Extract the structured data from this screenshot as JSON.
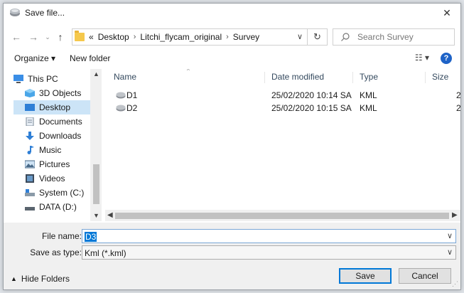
{
  "window": {
    "title": "Save file...",
    "close_label": "✕"
  },
  "address": {
    "back": "←",
    "forward": "→",
    "recent": "⌄",
    "up": "↑",
    "overflow": "«",
    "crumbs": [
      "Desktop",
      "Litchi_flycam_original",
      "Survey"
    ],
    "separator": "›",
    "dropdown": "∨",
    "refresh": "↻"
  },
  "search": {
    "placeholder": "Search Survey"
  },
  "toolbar": {
    "organize_label": "Organize ▾",
    "new_folder_label": "New folder",
    "view_label": "☷ ▾",
    "help_label": "?"
  },
  "nav": {
    "items": [
      {
        "label": "This PC",
        "icon": "pc-icon"
      },
      {
        "label": "3D Objects",
        "icon": "cube-icon"
      },
      {
        "label": "Desktop",
        "icon": "desktop-icon",
        "selected": true
      },
      {
        "label": "Documents",
        "icon": "document-icon"
      },
      {
        "label": "Downloads",
        "icon": "download-icon"
      },
      {
        "label": "Music",
        "icon": "music-icon"
      },
      {
        "label": "Pictures",
        "icon": "picture-icon"
      },
      {
        "label": "Videos",
        "icon": "video-icon"
      },
      {
        "label": "System (C:)",
        "icon": "drive-icon"
      },
      {
        "label": "DATA (D:)",
        "icon": "drive-icon"
      }
    ]
  },
  "file_list": {
    "columns": [
      "Name",
      "Date modified",
      "Type",
      "Size"
    ],
    "rows": [
      {
        "name": "D1",
        "date": "25/02/2020 10:14 SA",
        "type": "KML",
        "size": "2"
      },
      {
        "name": "D2",
        "date": "25/02/2020 10:15 SA",
        "type": "KML",
        "size": "2"
      }
    ]
  },
  "form": {
    "filename_label": "File name:",
    "filename_value": "D3",
    "savetype_label": "Save as type:",
    "savetype_value": "Kml (*.kml)"
  },
  "buttons": {
    "hide_folders": "Hide Folders",
    "save": "Save",
    "cancel": "Cancel"
  },
  "colors": {
    "accent": "#0078d7",
    "selected_bg": "#cce4f7",
    "help": "#1e63c7",
    "folder": "#f5c84c"
  }
}
